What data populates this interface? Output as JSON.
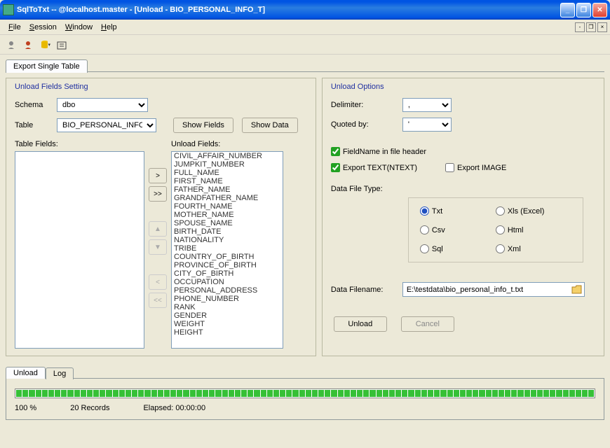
{
  "titlebar": {
    "text": "SqlToTxt -- @localhost.master - [Unload - BIO_PERSONAL_INFO_T]"
  },
  "menu": {
    "file": "File",
    "session": "Session",
    "window": "Window",
    "help": "Help"
  },
  "page_tab": "Export Single Table",
  "left": {
    "title": "Unload Fields Setting",
    "schema_label": "Schema",
    "schema_value": "dbo",
    "table_label": "Table",
    "table_value": "BIO_PERSONAL_INFO_T",
    "show_fields": "Show Fields",
    "show_data": "Show Data",
    "table_fields_label": "Table Fields:",
    "unload_fields_label": "Unload Fields:",
    "unload_fields": [
      "CIVIL_AFFAIR_NUMBER",
      "JUMPKIT_NUMBER",
      "FULL_NAME",
      "FIRST_NAME",
      "FATHER_NAME",
      "GRANDFATHER_NAME",
      "FOURTH_NAME",
      "MOTHER_NAME",
      "SPOUSE_NAME",
      "BIRTH_DATE",
      "NATIONALITY",
      "TRIBE",
      "COUNTRY_OF_BIRTH",
      "PROVINCE_OF_BIRTH",
      "CITY_OF_BIRTH",
      "OCCUPATION",
      "PERSONAL_ADDRESS",
      "PHONE_NUMBER",
      "RANK",
      "GENDER",
      "WEIGHT",
      "HEIGHT"
    ]
  },
  "right": {
    "title": "Unload Options",
    "delimiter_label": "Delimiter:",
    "delimiter_value": ",",
    "quoted_label": "Quoted by:",
    "quoted_value": "'",
    "chk_header": "FieldName in file header",
    "chk_text": "Export TEXT(NTEXT)",
    "chk_image": "Export IMAGE",
    "filetype_label": "Data File Type:",
    "radios": {
      "txt": "Txt",
      "xls": "Xls (Excel)",
      "csv": "Csv",
      "html": "Html",
      "sql": "Sql",
      "xml": "Xml"
    },
    "filename_label": "Data Filename:",
    "filename_value": "E:\\testdata\\bio_personal_info_t.txt",
    "btn_unload": "Unload",
    "btn_cancel": "Cancel"
  },
  "bottom": {
    "tab_unload": "Unload",
    "tab_log": "Log",
    "percent": "100 %",
    "records": "20 Records",
    "elapsed": "Elapsed: 00:00:00"
  }
}
